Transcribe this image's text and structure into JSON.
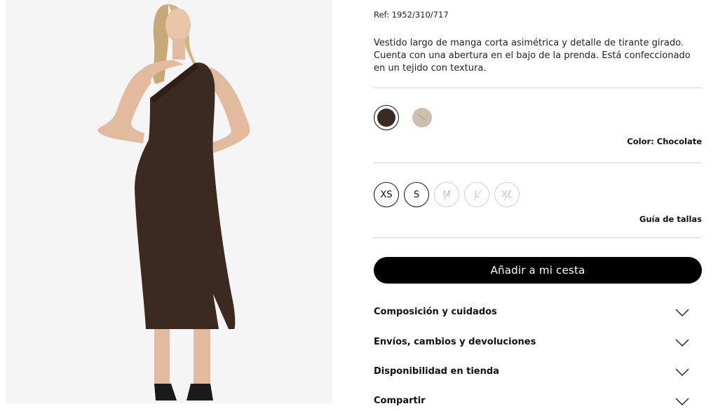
{
  "product": {
    "ref": "Ref: 1952/310/717",
    "description": "Vestido largo de manga corta asimétrica y detalle de tirante girado. Cuenta con una abertura en el bajo de la prenda. Está confeccionado en un tejido con textura."
  },
  "colors": {
    "options": [
      {
        "name": "Chocolate",
        "hex": "#3a2a20",
        "selected": true
      },
      {
        "name": "Beige",
        "hex": "#cbbfae",
        "selected": false
      }
    ],
    "label": "Color: Chocolate"
  },
  "sizes": {
    "options": [
      {
        "label": "XS",
        "available": true
      },
      {
        "label": "S",
        "available": true
      },
      {
        "label": "M",
        "available": false
      },
      {
        "label": "L",
        "available": false
      },
      {
        "label": "XL",
        "available": false
      }
    ],
    "guide_label": "Guía de tallas"
  },
  "cart": {
    "button_label": "Añadir a mi cesta"
  },
  "accordion": [
    {
      "label": "Composición y cuidados",
      "icon": "chevron-down-icon"
    },
    {
      "label": "Envíos, cambios y devoluciones",
      "icon": "chevron-down-icon"
    },
    {
      "label": "Disponibilidad en tienda",
      "icon": "chevron-down-icon"
    },
    {
      "label": "Compartir",
      "icon": "chevron-down-icon"
    }
  ],
  "theme": {
    "accent": "#000000",
    "divider": "#d4d4d4"
  }
}
